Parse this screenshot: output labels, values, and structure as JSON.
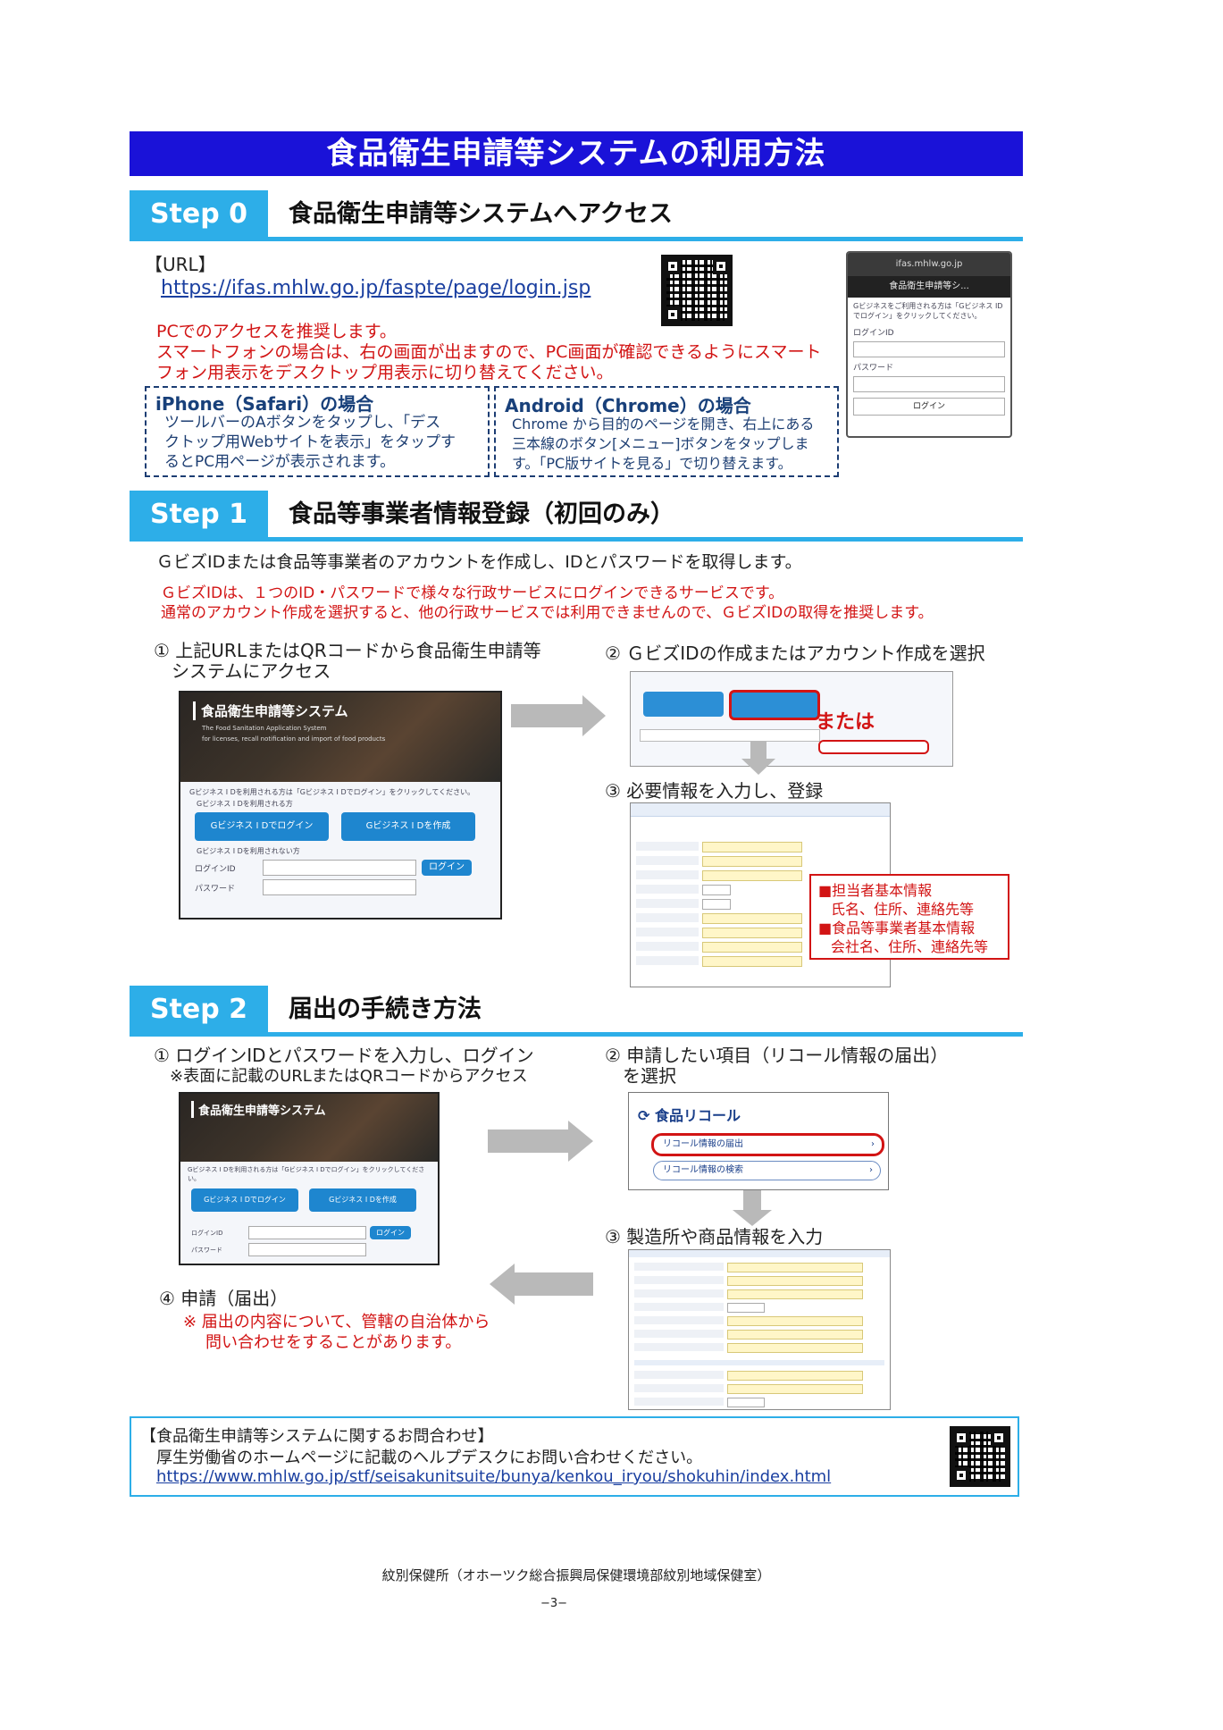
{
  "title": "食品衛生申請等システムの利用方法",
  "step0": {
    "tag": "Step 0",
    "heading": "食品衛生申請等システムへアクセス",
    "url_label": "【URL】",
    "url": "https://ifas.mhlw.go.jp/faspte/page/login.jsp",
    "red_lines": [
      "PCでのアクセスを推奨します。",
      "スマートフォンの場合は、右の画面が出ますので、PC画面が確認できるようにスマート",
      "フォン用表示をデスクトップ用表示に切り替えてください。"
    ],
    "iphone": {
      "title": "iPhone（Safari）の場合",
      "lines": [
        "ツールバーのAボタンをタップし、「デス",
        "クトップ用Webサイトを表示」をタップす",
        "るとPC用ページが表示されます。"
      ]
    },
    "android": {
      "title": "Android（Chrome）の場合",
      "lines": [
        "Chrome から目的のページを開き、右上にある",
        "三本線のボタン[メニュー]ボタンをタップしま",
        "す。「PC版サイトを見る」で切り替えます。"
      ]
    },
    "phone": {
      "address": "ifas.mhlw.go.jp",
      "header": "食品衛生申請等シ...",
      "notice": "Gビジネスをご利用される方は「Gビジネス IDでログイン」をクリックしてください。",
      "login_id": "ログインID",
      "password": "パスワード",
      "login_btn": "ログイン"
    }
  },
  "step1": {
    "tag": "Step 1",
    "heading": "食品等事業者情報登録（初回のみ）",
    "intro": "ＧビズIDまたは食品等事業者のアカウントを作成し、IDとパスワードを取得します。",
    "red_lines": [
      "ＧビズIDは、１つのID・パスワードで様々な行政サービスにログインできるサービスです。",
      "通常のアカウント作成を選択すると、他の行政サービスでは利用できませんので、ＧビズIDの取得を推奨します。"
    ],
    "sub1": [
      "① 上記URLまたはQRコードから食品衛生申請等",
      "システムにアクセス"
    ],
    "sub2": "② ＧビズIDの作成またはアカウント作成を選択",
    "sub3": "③ 必要情報を入力し、登録",
    "or_label": "または",
    "callout": [
      "■担当者基本情報",
      "氏名、住所、連絡先等",
      "■食品等事業者基本情報",
      "会社名、住所、連絡先等"
    ],
    "shot": {
      "brand": "食品衛生申請等システム",
      "tagline1": "The Food Sanitation Application System",
      "tagline2": "for licenses, recall notification and import of food products",
      "notice": "Gビジネス I Dを利用される方は「Gビジネス I Dでログイン」をクリックしてください。",
      "gbiz_group": "Gビジネス I Dを利用される方",
      "gbiz_login": "Gビジネス I Dでログイン",
      "gbiz_create": "Gビジネス I Dを作成",
      "other_group": "Gビジネス I Dを利用されない方",
      "login_id": "ログインID",
      "password": "パスワード",
      "login_btn": "ログイン"
    }
  },
  "step2": {
    "tag": "Step 2",
    "heading": "届出の手続き方法",
    "sub1": [
      "① ログインIDとパスワードを入力し、ログイン",
      "※表面に記載のURLまたはQRコードからアクセス"
    ],
    "sub2": [
      "② 申請したい項目（リコール情報の届出）",
      "を選択"
    ],
    "sub3": "③ 製造所や商品情報を入力",
    "sub4": "④ 申請（届出）",
    "sub4_note": [
      "※ 届出の内容について、管轄の自治体から",
      "問い合わせをすることがあります。"
    ],
    "recall": {
      "title": "食品リコール",
      "item1": "リコール情報の届出",
      "item2": "リコール情報の検索"
    }
  },
  "contact": {
    "title": "【食品衛生申請等システムに関するお問合わせ】",
    "body": "厚生労働省のホームページに記載のヘルプデスクにお問い合わせください。",
    "url": "https://www.mhlw.go.jp/stf/seisakunitsuite/bunya/kenkou_iryou/shokuhin/index.html"
  },
  "footer": {
    "office": "紋別保健所（オホーツク総合振興局保健環境部紋別地域保健室）",
    "page": "−3−"
  },
  "colors": {
    "title_bg": "#1a12d8",
    "step_accent": "#2daee8",
    "warning_red": "#d21414",
    "link_blue": "#1a3fa0"
  }
}
